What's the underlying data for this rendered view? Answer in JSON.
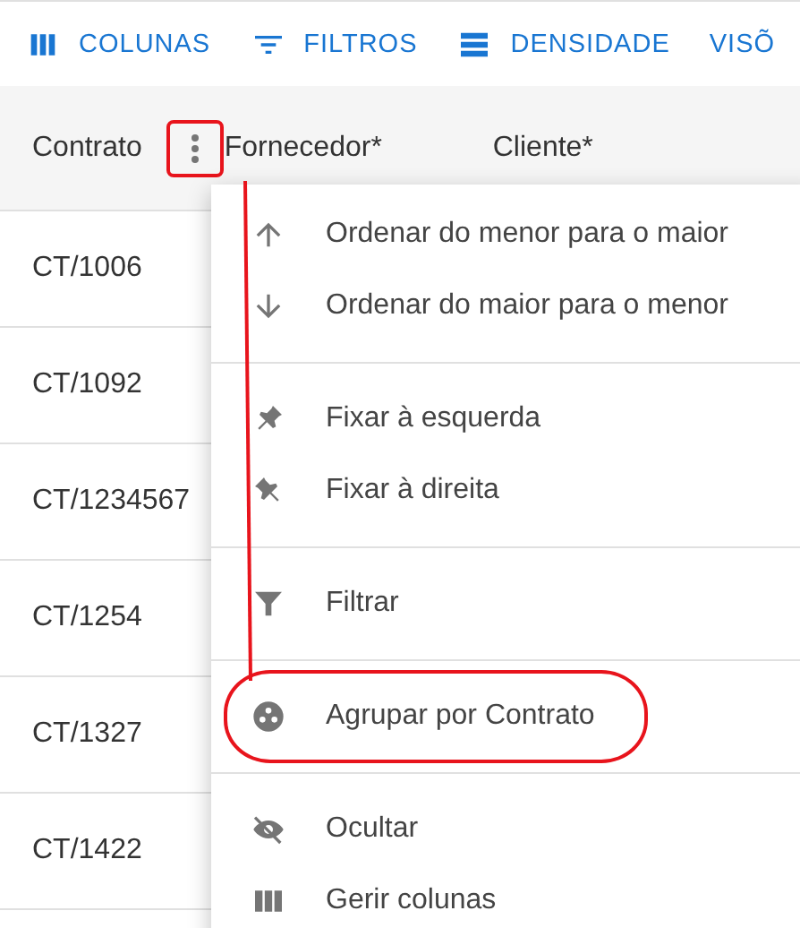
{
  "toolbar": [
    {
      "kind": "columns",
      "label": "COLUNAS"
    },
    {
      "kind": "filters",
      "label": "FILTROS"
    },
    {
      "kind": "density",
      "label": "DENSIDADE"
    },
    {
      "kind": "text",
      "label": "VISÕ"
    }
  ],
  "header": {
    "columns": [
      "Contrato",
      "Fornecedor*",
      "Cliente*"
    ],
    "menu_button": {
      "highlighted": true
    }
  },
  "rows": [
    "CT/1006",
    "CT/1092",
    "CT/1234567",
    "CT/1254",
    "CT/1327",
    "CT/1422"
  ],
  "menu": [
    {
      "kind": "sort-asc",
      "label": "Ordenar do menor para o maior",
      "highlighted": false,
      "divider_after": false
    },
    {
      "kind": "sort-desc",
      "label": "Ordenar do maior para o menor",
      "highlighted": false,
      "divider_after": true
    },
    {
      "kind": "pin-left",
      "label": "Fixar à esquerda",
      "highlighted": false,
      "divider_after": false
    },
    {
      "kind": "pin-right",
      "label": "Fixar à direita",
      "highlighted": false,
      "divider_after": true
    },
    {
      "kind": "filter",
      "label": "Filtrar",
      "highlighted": false,
      "divider_after": true
    },
    {
      "kind": "group",
      "label": "Agrupar por Contrato",
      "highlighted": true,
      "divider_after": true
    },
    {
      "kind": "hide",
      "label": "Ocultar",
      "highlighted": false,
      "divider_after": false
    },
    {
      "kind": "columns",
      "label": "Gerir colunas",
      "highlighted": false,
      "divider_after": false
    }
  ]
}
